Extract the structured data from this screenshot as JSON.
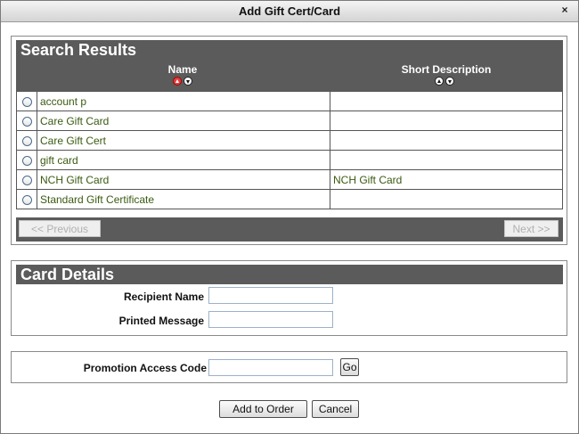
{
  "dialog": {
    "title": "Add Gift Cert/Card",
    "close_label": "×"
  },
  "search_results": {
    "heading": "Search Results",
    "columns": {
      "name": "Name",
      "short_description": "Short Description"
    },
    "rows": [
      {
        "name": "account p",
        "description": ""
      },
      {
        "name": "Care Gift Card",
        "description": ""
      },
      {
        "name": "Care Gift Cert",
        "description": ""
      },
      {
        "name": "gift card",
        "description": ""
      },
      {
        "name": "NCH Gift Card",
        "description": "NCH Gift Card"
      },
      {
        "name": "Standard Gift Certificate",
        "description": ""
      }
    ],
    "previous_label": "<< Previous",
    "next_label": "Next >>"
  },
  "card_details": {
    "heading": "Card Details",
    "recipient_label": "Recipient Name",
    "recipient_value": "",
    "message_label": "Printed Message",
    "message_value": ""
  },
  "promotion": {
    "label": "Promotion Access Code",
    "value": "",
    "go_label": "Go"
  },
  "actions": {
    "add_label": "Add to Order",
    "cancel_label": "Cancel"
  },
  "colors": {
    "header_bg": "#5b5b5b",
    "link_text": "#3a5a10"
  }
}
